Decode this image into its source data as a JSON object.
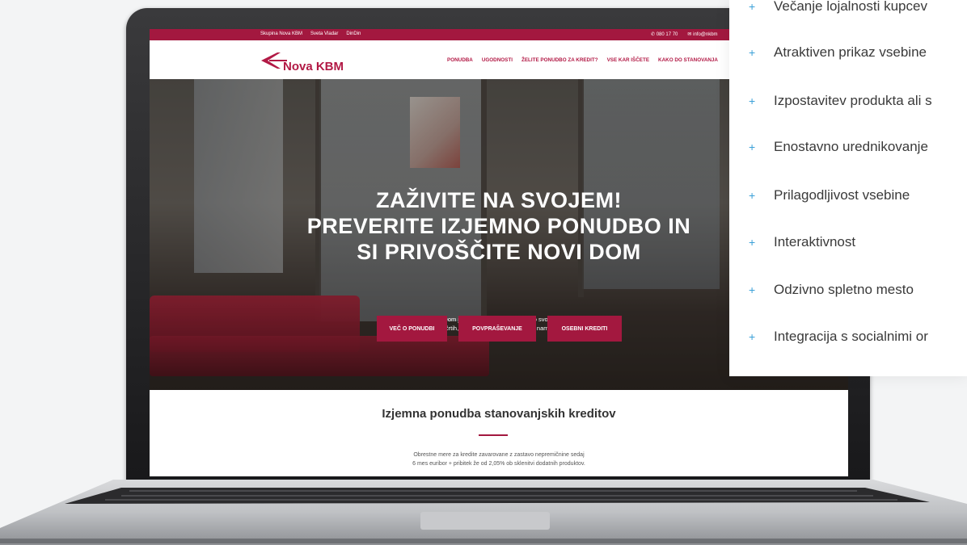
{
  "website": {
    "topbar": {
      "links": [
        "Skupina Nova KBM",
        "Sveta Vladar",
        "DinDin"
      ],
      "phone": "080 17 70",
      "email": "info@nkbm"
    },
    "logo_text": "Nova KBM",
    "nav": [
      "PONUDBA",
      "UGODNOSTI",
      "ŽELITE PONUDBO ZA KREDIT?",
      "VSE KAR IŠČETE",
      "KAKO DO STANOVANJA"
    ],
    "hero": {
      "title_line1": "ZAŽIVITE NA SVOJEM!",
      "title_line2": "PREVERITE IZJEMNO PONUDBO IN",
      "title_line3": "SI PRIVOŠČITE NOVI DOM",
      "sub_line1": "Dom je prostor, v katerem živite po svoje.",
      "sub_line2": "Zgrajen po vaših načrtih, opremljen po vaših željah in namenjen vašemu užitku.",
      "buttons": [
        "VEČ O PONUDBI",
        "POVPRAŠEVANJE",
        "OSEBNI KREDITI"
      ]
    },
    "section": {
      "title": "Izjemna ponudba stanovanjskih kreditov",
      "text_line1": "Obrestne mere za kredite zavarovane z zastavo nepremičnine sedaj",
      "text_line2": "6 mes euribor + pribitek že od 2,05% ob sklenitvi dodatnih produktov."
    }
  },
  "features": {
    "plus_symbol": "+",
    "items": [
      "Večanje lojalnosti kupcev",
      "Atraktiven prikaz vsebine",
      "Izpostavitev produkta ali s",
      "Enostavno urednikovanje",
      "Prilagodljivost vsebine",
      "Interaktivnost",
      "Odzivno spletno mesto",
      "Integracija s socialnimi or"
    ]
  },
  "colors": {
    "brand": "#a3183f",
    "accent_plus": "#3aa0d8"
  }
}
